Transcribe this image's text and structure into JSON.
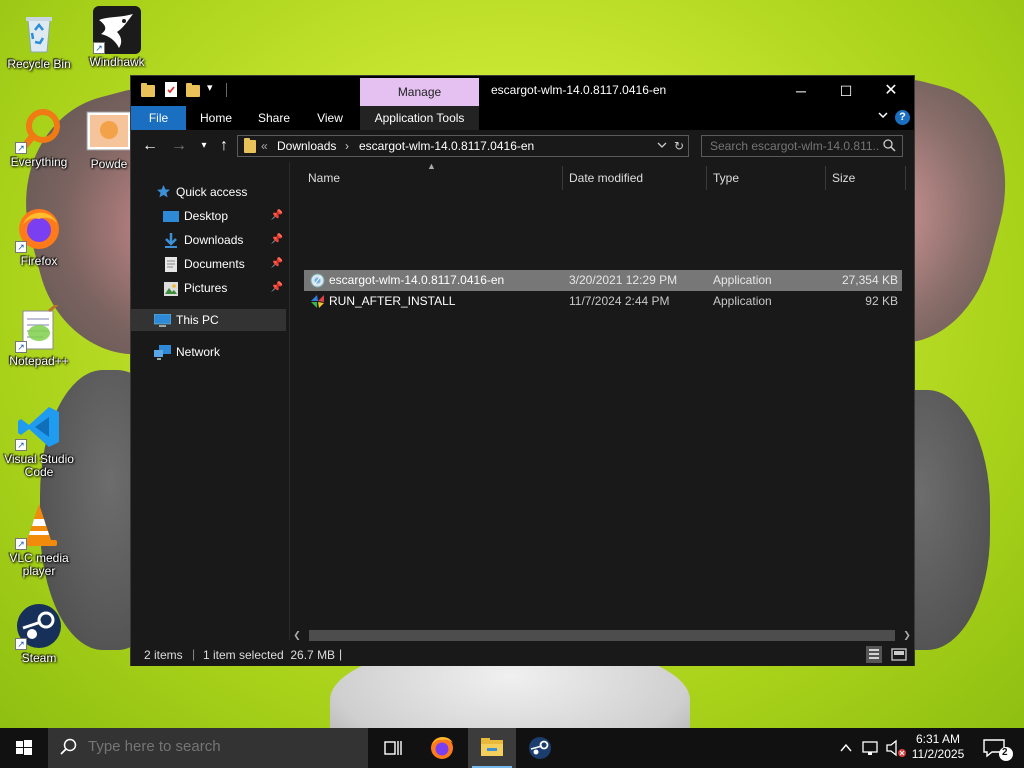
{
  "desktop": {
    "icons": [
      {
        "label": "Recycle Bin"
      },
      {
        "label": "Windhawk"
      },
      {
        "label": "Everything"
      },
      {
        "label": "Powde"
      },
      {
        "label": "Firefox"
      },
      {
        "label": "Notepad++"
      },
      {
        "label": "Visual Studio Code"
      },
      {
        "label": "VLC media player"
      },
      {
        "label": "Steam"
      }
    ]
  },
  "window": {
    "title": "escargot-wlm-14.0.8117.0416-en",
    "manage_label": "Manage",
    "ribbon_tabs": [
      "File",
      "Home",
      "Share",
      "View",
      "Application Tools"
    ],
    "help_glyph": "?",
    "address": {
      "overflow": "«",
      "crumbs": [
        "Downloads",
        "escargot-wlm-14.0.8117.0416-en"
      ]
    },
    "search": {
      "placeholder": "Search escargot-wlm-14.0.811..."
    },
    "nav": {
      "quick_access": "Quick access",
      "pinned": [
        "Desktop",
        "Downloads",
        "Documents",
        "Pictures"
      ],
      "this_pc": "This PC",
      "network": "Network"
    },
    "columns": [
      "Name",
      "Date modified",
      "Type",
      "Size"
    ],
    "files": [
      {
        "name": "escargot-wlm-14.0.8117.0416-en",
        "date": "3/20/2021 12:29 PM",
        "type": "Application",
        "size": "27,354 KB",
        "selected": true
      },
      {
        "name": "RUN_AFTER_INSTALL",
        "date": "11/7/2024 2:44 PM",
        "type": "Application",
        "size": "92 KB",
        "selected": false
      }
    ],
    "status": {
      "items": "2 items",
      "selection": "1 item selected  26.7 MB"
    }
  },
  "taskbar": {
    "search_placeholder": "Type here to search",
    "clock": {
      "time": "6:31 AM",
      "date": "11/2/2025"
    },
    "notifications_count": "2"
  },
  "colors": {
    "accent": "#1a6fc0",
    "manage_tab": "#e5c1f2",
    "window_bg": "#191919",
    "selected_row": "#777777"
  }
}
